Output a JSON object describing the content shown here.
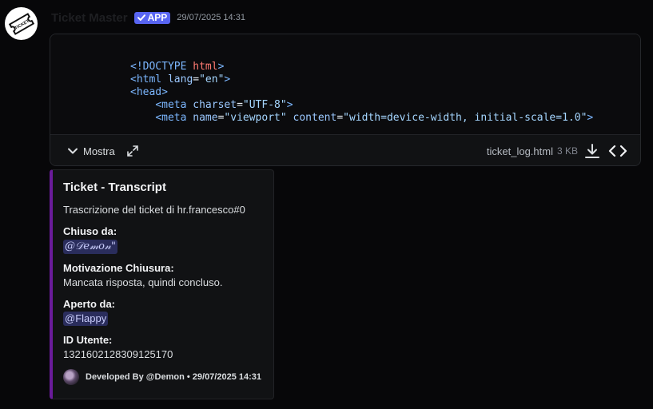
{
  "message": {
    "author": "Ticket Master",
    "badge": "APP",
    "timestamp": "29/07/2025 14:31",
    "avatar_icon": "ticket-icon",
    "avatar_text": "TICKET"
  },
  "attachment": {
    "code_lines": [
      [
        {
          "t": "tag",
          "v": "<!DOCTYPE "
        },
        {
          "t": "kw",
          "v": "html"
        },
        {
          "t": "tag",
          "v": ">"
        }
      ],
      [
        {
          "t": "tag",
          "v": "<html "
        },
        {
          "t": "attr",
          "v": "lang"
        },
        {
          "t": "plain",
          "v": "="
        },
        {
          "t": "str",
          "v": "\"en\""
        },
        {
          "t": "tag",
          "v": ">"
        }
      ],
      [
        {
          "t": "tag",
          "v": "<head>"
        }
      ],
      [
        {
          "t": "plain",
          "v": "    "
        },
        {
          "t": "tag",
          "v": "<meta "
        },
        {
          "t": "attr",
          "v": "charset"
        },
        {
          "t": "plain",
          "v": "="
        },
        {
          "t": "str",
          "v": "\"UTF-8\""
        },
        {
          "t": "tag",
          "v": ">"
        }
      ],
      [
        {
          "t": "plain",
          "v": "    "
        },
        {
          "t": "tag",
          "v": "<meta "
        },
        {
          "t": "attr",
          "v": "name"
        },
        {
          "t": "plain",
          "v": "="
        },
        {
          "t": "str",
          "v": "\"viewport\""
        },
        {
          "t": "plain",
          "v": " "
        },
        {
          "t": "attr",
          "v": "content"
        },
        {
          "t": "plain",
          "v": "="
        },
        {
          "t": "str",
          "v": "\"width=device-width, initial-scale=1.0\""
        },
        {
          "t": "tag",
          "v": ">"
        }
      ]
    ],
    "show_label": "Mostra",
    "file_name": "ticket_log.html",
    "file_size": "3 KB"
  },
  "embed": {
    "accent_color": "#6a1b9a",
    "title": "Ticket - Transcript",
    "description": "Trascrizione del ticket di hr.francesco#0",
    "fields": {
      "closed_by": {
        "name": "Chiuso da:",
        "value": "@𝒟𝑒𝓂𝑜𝓃\""
      },
      "close_reason": {
        "name": "Motivazione Chiusura:",
        "value": "Mancata risposta, quindi concluso."
      },
      "opened_by": {
        "name": "Aperto da:",
        "value": "@Flappy"
      },
      "user_id": {
        "name": "ID Utente:",
        "value": "1321602128309125170"
      }
    },
    "footer": "Developed By @Demon • 29/07/2025 14:31"
  }
}
